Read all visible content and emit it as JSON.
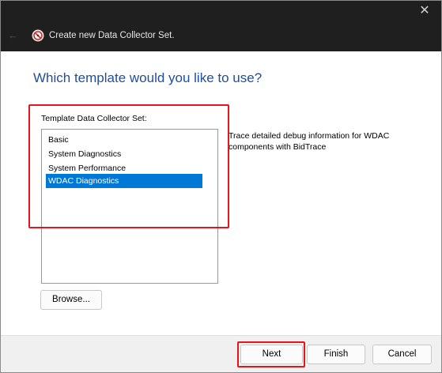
{
  "window": {
    "title": "Create new Data Collector Set.",
    "close_glyph": "✕",
    "back_glyph": "←"
  },
  "page": {
    "heading": "Which template would you like to use?"
  },
  "template_list": {
    "label": "Template Data Collector Set:",
    "items": [
      {
        "label": "Basic",
        "selected": false
      },
      {
        "label": "System Diagnostics",
        "selected": false
      },
      {
        "label": "System Performance",
        "selected": false
      },
      {
        "label": "WDAC Diagnostics",
        "selected": true
      }
    ]
  },
  "description": {
    "text": "Trace detailed debug information for WDAC components with BidTrace"
  },
  "buttons": {
    "browse": "Browse...",
    "next": "Next",
    "finish": "Finish",
    "cancel": "Cancel"
  },
  "colors": {
    "titlebar": "#1f1f1f",
    "heading": "#1e4e9e",
    "selection": "#0078d7",
    "annotation": "#e8141b"
  }
}
